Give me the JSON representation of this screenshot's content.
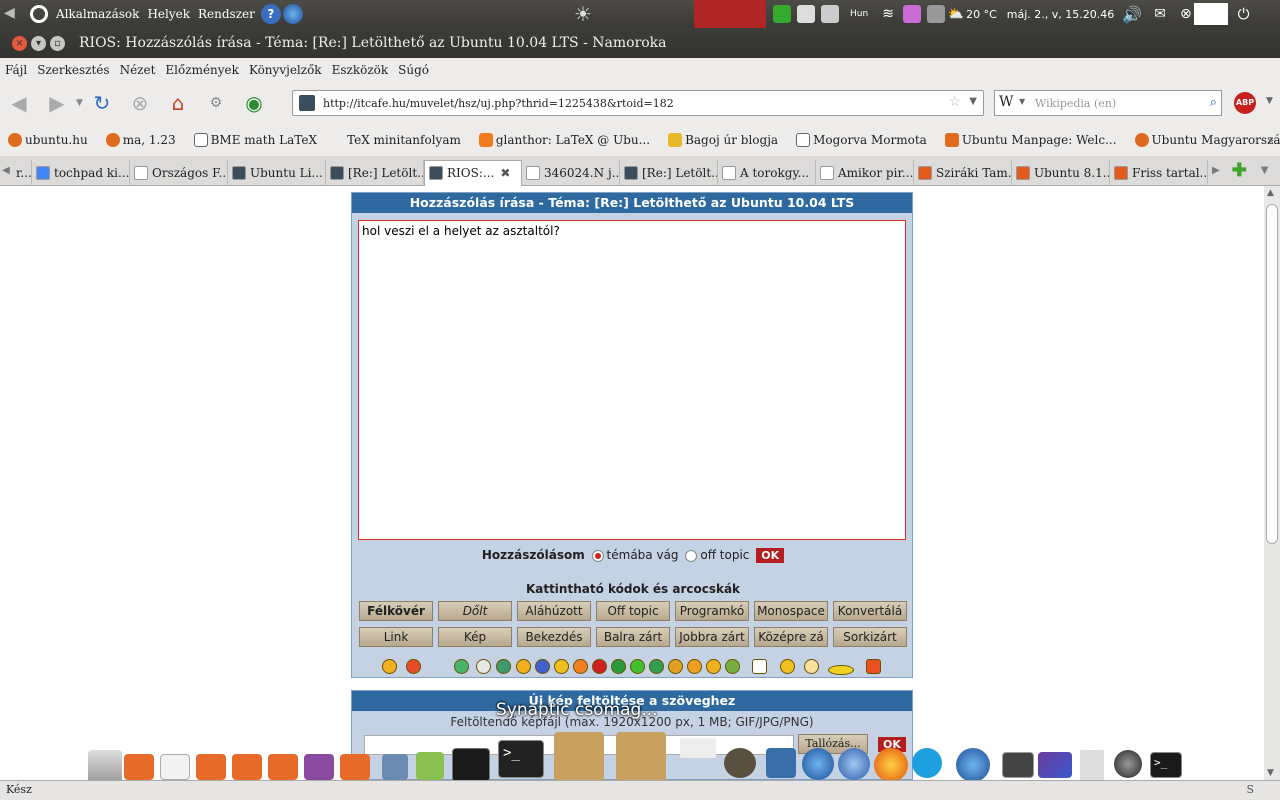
{
  "top_panel": {
    "menus": [
      "Alkalmazások",
      "Helyek",
      "Rendszer"
    ],
    "keyboard_layout": "Hun",
    "weather": "20 °C",
    "clock": "máj. 2., v, 15.20.46"
  },
  "window": {
    "title": "RIOS: Hozzászólás írása - Téma: [Re:] Letölthető az Ubuntu 10.04 LTS - Namoroka"
  },
  "menubar": [
    "Fájl",
    "Szerkesztés",
    "Nézet",
    "Előzmények",
    "Könyvjelzők",
    "Eszközök",
    "Súgó"
  ],
  "navigation": {
    "url": "http://itcafe.hu/muvelet/hsz/uj.php?thrid=1225438&rtoid=182",
    "search_placeholder": "Wikipedia (en)"
  },
  "bookmarks": [
    "ubuntu.hu",
    "ma, 1.23",
    "BME math LaTeX",
    "TeX minitanfolyam",
    "glanthor: LaTeX @ Ubu...",
    "Bagoj úr blogja",
    "Mogorva Mormota",
    "Ubuntu Manpage: Welc...",
    "Ubuntu Magyarország"
  ],
  "tabs": [
    {
      "label": "r...",
      "active": false
    },
    {
      "label": "tochpad ki...",
      "active": false
    },
    {
      "label": "Országos F...",
      "active": false
    },
    {
      "label": "Ubuntu Li...",
      "active": false
    },
    {
      "label": "[Re:] Letölt...",
      "active": false
    },
    {
      "label": "RIOS:...",
      "active": true
    },
    {
      "label": "346024.N j...",
      "active": false
    },
    {
      "label": "[Re:] Letölt...",
      "active": false
    },
    {
      "label": "A torokgy...",
      "active": false
    },
    {
      "label": "Amikor pir...",
      "active": false
    },
    {
      "label": "Sziráki Tam...",
      "active": false
    },
    {
      "label": "Ubuntu 8.1...",
      "active": false
    },
    {
      "label": "Friss tartal...",
      "active": false
    }
  ],
  "post_form": {
    "header": "Hozzászólás írása - Téma: [Re:] Letölthető az Ubuntu 10.04 LTS",
    "text": "hol veszi el a helyet az asztaltól?",
    "reply_label": "Hozzászólásom",
    "option_on_topic": "témába vág",
    "option_off_topic": "off topic",
    "ok_label": "OK",
    "codes_title": "Kattintható kódok és arcocskák",
    "code_buttons": [
      "Félkövér",
      "Dőlt",
      "Aláhúzott",
      "Off topic",
      "Programkó",
      "Monospace",
      "Konvertálá",
      "Link",
      "Kép",
      "Bekezdés",
      "Balra zárt",
      "Jobbra zárt",
      "Középre zá",
      "Sorkizárt"
    ]
  },
  "upload_form": {
    "header": "Új kép feltöltése a szöveghez",
    "subtitle": "Feltöltendő képfájl (max. 1920x1200 px, 1 MB; GIF/JPG/PNG)",
    "browse_label": "Tallózás...",
    "ok_label": "OK"
  },
  "notification": "Synaptic csomag...",
  "status": "Kész"
}
